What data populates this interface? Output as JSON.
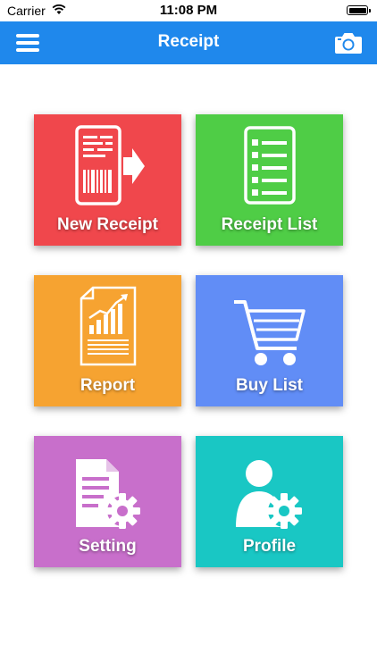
{
  "status_bar": {
    "carrier": "Carrier",
    "time": "11:08 PM"
  },
  "nav": {
    "title": "Receipt"
  },
  "tiles": [
    {
      "label": "New Receipt",
      "color": "#f0474c",
      "icon": "new-receipt-icon"
    },
    {
      "label": "Receipt List",
      "color": "#4fcd46",
      "icon": "receipt-list-icon"
    },
    {
      "label": "Report",
      "color": "#f6a331",
      "icon": "report-icon"
    },
    {
      "label": "Buy List",
      "color": "#618df6",
      "icon": "cart-icon"
    },
    {
      "label": "Setting",
      "color": "#c86fcb",
      "icon": "settings-document-icon"
    },
    {
      "label": "Profile",
      "color": "#19c7c4",
      "icon": "profile-settings-icon"
    }
  ]
}
